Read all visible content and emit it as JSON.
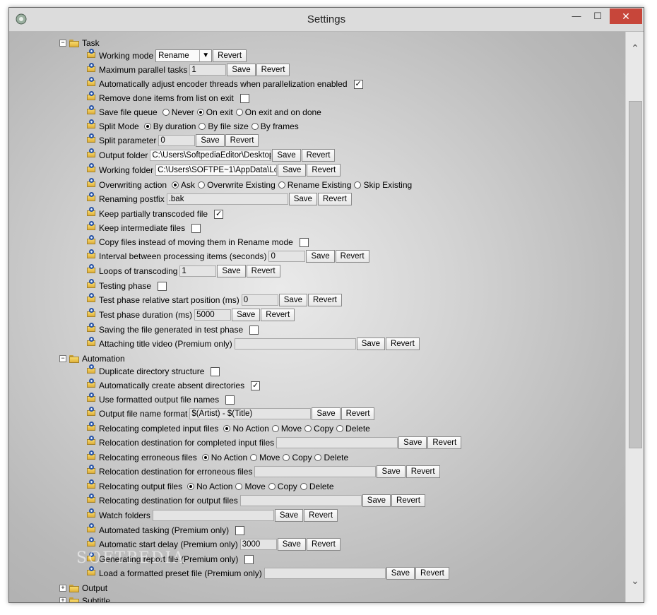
{
  "window": {
    "title": "Settings",
    "min": "—",
    "max": "☐",
    "close": "✕"
  },
  "buttons": {
    "save": "Save",
    "revert": "Revert"
  },
  "scrollbar": {
    "up": "⌃",
    "down": "⌄"
  },
  "watermark": "SOFTPEDIA",
  "sections": {
    "task": "Task",
    "automation": "Automation",
    "output": "Output",
    "subtitle": "Subtitle"
  },
  "expanders": {
    "expanded": "−",
    "collapsed": "+"
  },
  "check": "✓",
  "task": {
    "working_mode": {
      "label": "Working mode",
      "value": "Rename"
    },
    "max_parallel": {
      "label": "Maximum parallel tasks",
      "value": "1"
    },
    "auto_adjust": {
      "label": "Automatically adjust encoder threads when parallelization enabled",
      "checked": true
    },
    "remove_done": {
      "label": "Remove done items from list on exit",
      "checked": false
    },
    "save_queue": {
      "label": "Save file queue",
      "options": [
        "Never",
        "On exit",
        "On exit and on done"
      ],
      "selected": 1
    },
    "split_mode": {
      "label": "Split Mode",
      "options": [
        "By duration",
        "By file size",
        "By frames"
      ],
      "selected": 0
    },
    "split_param": {
      "label": "Split parameter",
      "value": "0"
    },
    "output_folder": {
      "label": "Output folder",
      "value": "C:\\Users\\SoftpediaEditor\\Desktop\\"
    },
    "working_folder": {
      "label": "Working folder",
      "value": "C:\\Users\\SOFTPE~1\\AppData\\Local"
    },
    "overwriting": {
      "label": "Overwriting action",
      "options": [
        "Ask",
        "Overwrite Existing",
        "Rename Existing",
        "Skip Existing"
      ],
      "selected": 0
    },
    "renaming_postfix": {
      "label": "Renaming postfix",
      "value": ".bak"
    },
    "keep_partial": {
      "label": "Keep partially transcoded file",
      "checked": true
    },
    "keep_intermediate": {
      "label": "Keep intermediate files",
      "checked": false
    },
    "copy_files": {
      "label": "Copy files instead of moving them in Rename mode",
      "checked": false
    },
    "interval": {
      "label": "Interval between processing items (seconds)",
      "value": "0"
    },
    "loops": {
      "label": "Loops of transcoding",
      "value": "1"
    },
    "testing_phase": {
      "label": "Testing phase",
      "checked": false
    },
    "test_start": {
      "label": "Test phase relative start position (ms)",
      "value": "0"
    },
    "test_duration": {
      "label": "Test phase duration (ms)",
      "value": "5000"
    },
    "saving_test": {
      "label": "Saving the file generated in test phase",
      "checked": false
    },
    "title_video": {
      "label": "Attaching title video (Premium only)",
      "value": ""
    }
  },
  "automation": {
    "dup_dir": {
      "label": "Duplicate directory structure",
      "checked": false
    },
    "auto_create": {
      "label": "Automatically create absent directories",
      "checked": true
    },
    "formatted_names": {
      "label": "Use formatted output file names",
      "checked": false
    },
    "name_format": {
      "label": "Output file name format",
      "value": "$(Artist) - $(Title)"
    },
    "reloc_completed": {
      "label": "Relocating completed input files",
      "options": [
        "No Action",
        "Move",
        "Copy",
        "Delete"
      ],
      "selected": 0
    },
    "reloc_dest_completed": {
      "label": "Relocation destination for completed input files",
      "value": ""
    },
    "reloc_err": {
      "label": "Relocating erroneous files",
      "options": [
        "No Action",
        "Move",
        "Copy",
        "Delete"
      ],
      "selected": 0
    },
    "reloc_dest_err": {
      "label": "Relocation destination for erroneous files",
      "value": ""
    },
    "reloc_out": {
      "label": "Relocating output files",
      "options": [
        "No Action",
        "Move",
        "Copy",
        "Delete"
      ],
      "selected": 0
    },
    "reloc_dest_out": {
      "label": "Relocating destination for output files",
      "value": ""
    },
    "watch_folders": {
      "label": "Watch folders",
      "value": ""
    },
    "auto_tasking": {
      "label": "Automated tasking (Premium only)",
      "checked": false
    },
    "auto_delay": {
      "label": "Automatic start delay (Premium only)",
      "value": "3000"
    },
    "gen_report": {
      "label": "Generating report file (Premium only)",
      "checked": false
    },
    "load_preset": {
      "label": "Load a formatted preset file (Premium only)",
      "value": ""
    }
  }
}
